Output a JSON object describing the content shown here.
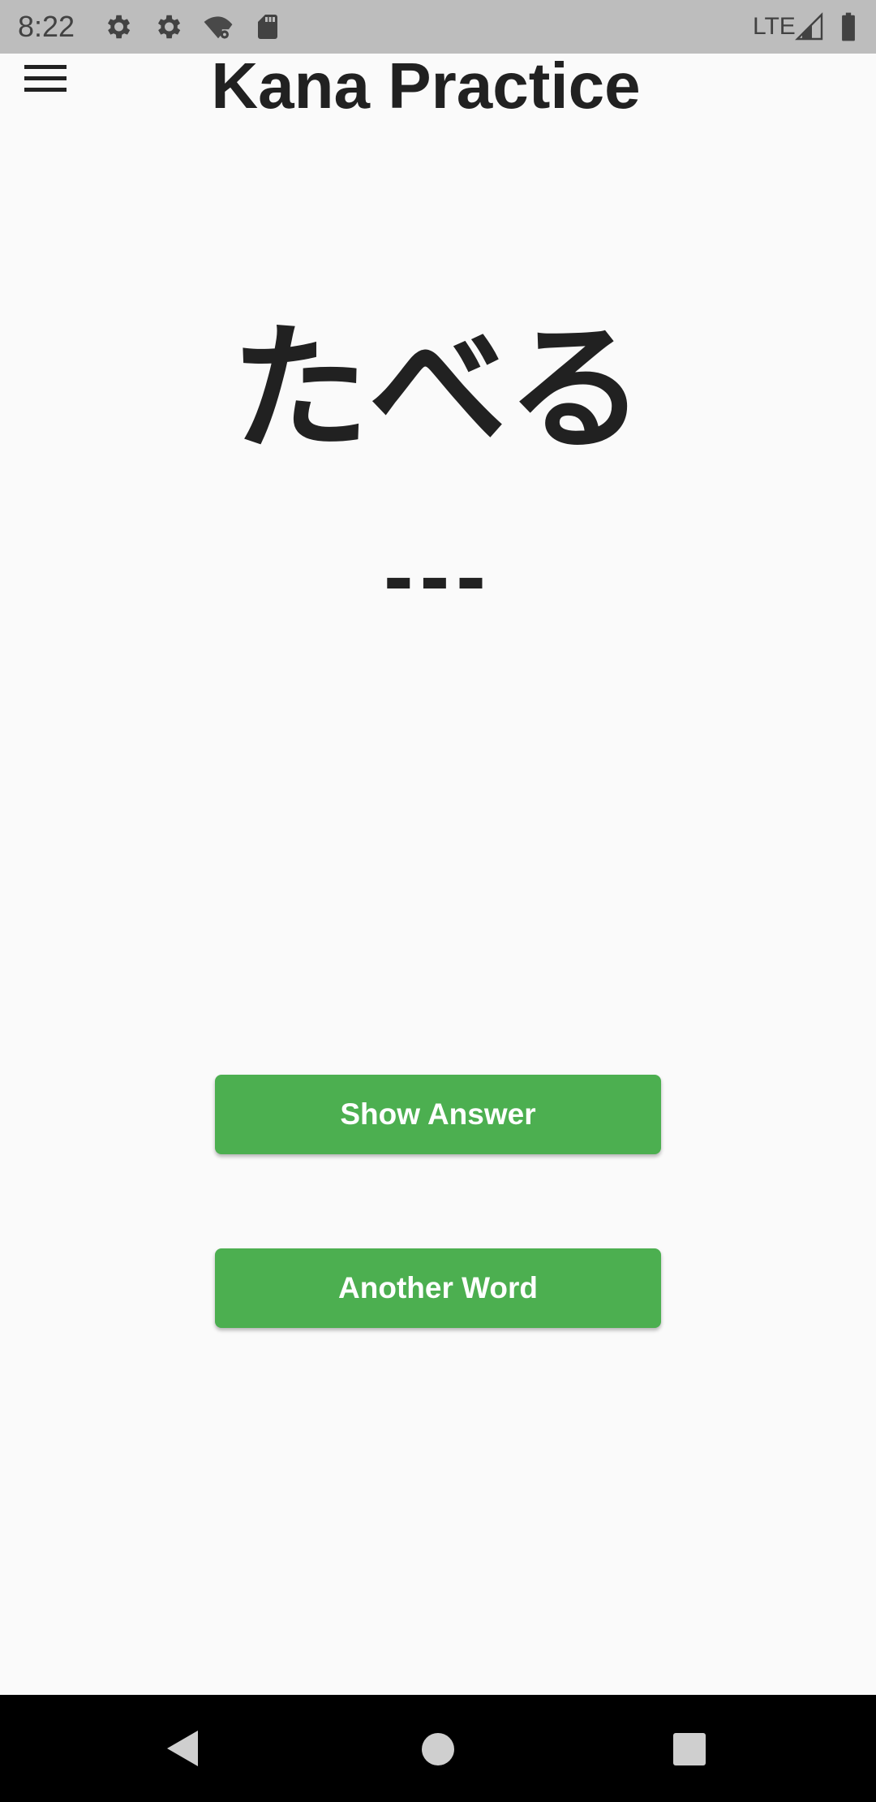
{
  "status_bar": {
    "time": "8:22",
    "network": "LTE",
    "icons": [
      "settings-gear-icon",
      "settings-gear-icon",
      "wifi-settings-icon",
      "sd-card-icon",
      "signal-icon",
      "battery-icon"
    ]
  },
  "app_bar": {
    "title": "Kana Practice",
    "menu_icon": "hamburger-menu-icon"
  },
  "practice": {
    "word": "たべる",
    "answer_placeholder": "---"
  },
  "buttons": {
    "show_answer": "Show Answer",
    "another_word": "Another Word"
  },
  "nav_bar": {
    "icons": [
      "back-icon",
      "home-icon",
      "recents-icon"
    ]
  },
  "colors": {
    "accent": "#4caf50",
    "status_bar": "#bdbdbd",
    "background": "#fafafa",
    "text": "#212121"
  }
}
